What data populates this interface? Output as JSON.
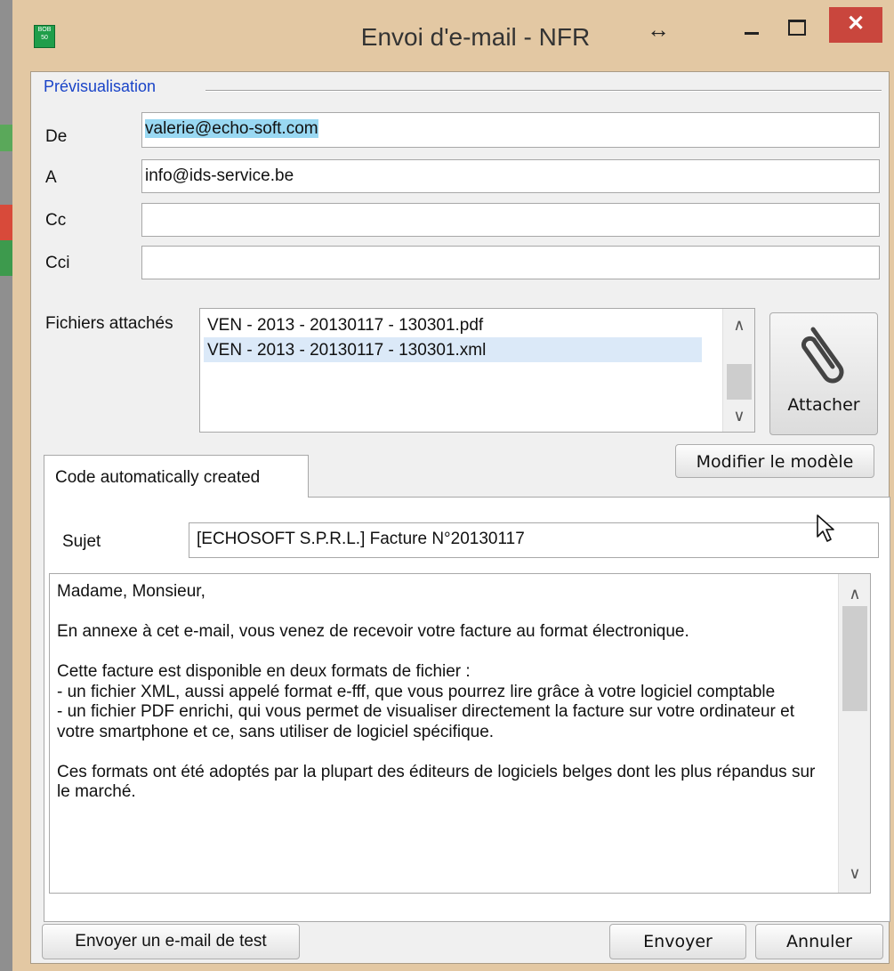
{
  "window": {
    "title": "Envoi d'e-mail - NFR",
    "resize_icon": "↔",
    "close_glyph": "✕",
    "app_icon_text": "BOB 50"
  },
  "preview": {
    "section_title": "Prévisualisation",
    "from_label": "De",
    "from_value": "valerie@echo-soft.com",
    "to_label": "A",
    "to_value": "info@ids-service.be",
    "cc_label": "Cc",
    "cc_value": "",
    "bcc_label": "Cci",
    "bcc_value": ""
  },
  "attachments": {
    "label": "Fichiers attachés",
    "files": [
      "VEN - 2013 - 20130117 - 130301.pdf",
      "VEN - 2013 - 20130117 - 130301.xml"
    ],
    "attach_button": "Attacher",
    "attach_icon": "paperclip-icon"
  },
  "template": {
    "modify_button": "Modifier le modèle",
    "tab_label": "Code automatically created"
  },
  "message": {
    "subject_label": "Sujet",
    "subject_value": "[ECHOSOFT S.P.R.L.] Facture N°20130117",
    "body": [
      "Madame, Monsieur,",
      "En annexe à cet e-mail, vous venez de recevoir votre facture au format électronique.",
      "Cette facture est disponible en deux formats de fichier :\n- un fichier XML, aussi appelé format e-fff, que vous pourrez lire grâce à votre logiciel comptable\n- un fichier PDF enrichi, qui vous permet de visualiser directement la facture sur votre ordinateur et votre smartphone et ce, sans utiliser de logiciel spécifique.",
      "Ces formats ont été adoptés par la plupart des éditeurs de logiciels belges dont les plus répandus sur le marché."
    ]
  },
  "footer": {
    "test_button": "Envoyer un e-mail de test",
    "send_button": "Envoyer",
    "cancel_button": "Annuler"
  },
  "colors": {
    "window_frame": "#e3c8a3",
    "close_button": "#c9463d",
    "section_title": "#1a44c8",
    "selection": "#99d8f2"
  }
}
